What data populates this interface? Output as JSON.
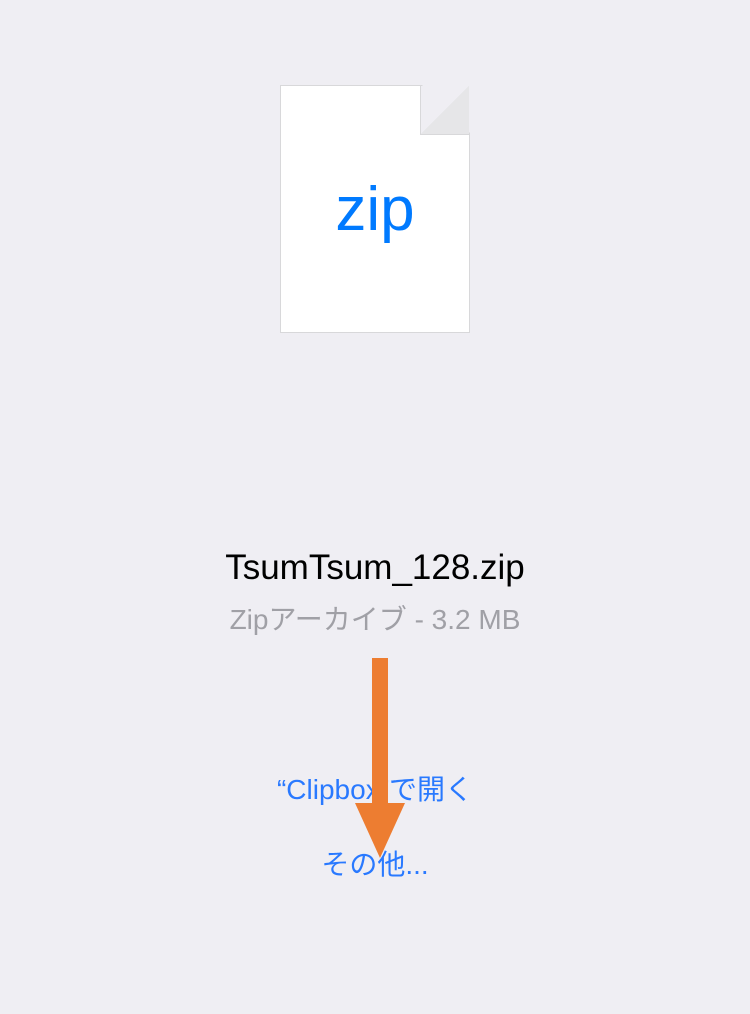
{
  "file": {
    "icon_label": "zip",
    "name": "TsumTsum_128.zip",
    "meta": "Zipアーカイブ - 3.2 MB"
  },
  "actions": {
    "open_in": "“Clipbox”で開く",
    "more": "その他..."
  },
  "annotation": {
    "arrow_color": "#ed7d31"
  }
}
